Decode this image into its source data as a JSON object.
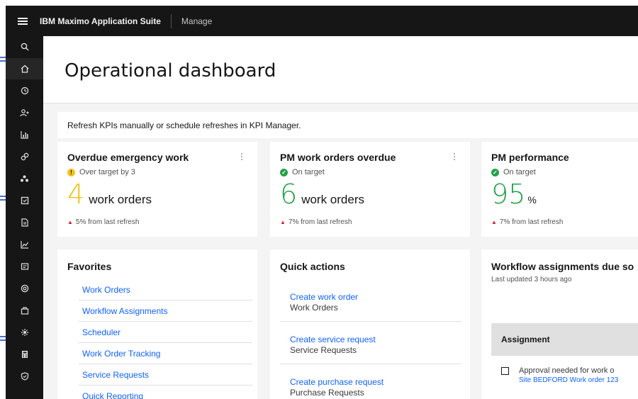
{
  "topbar": {
    "brand": "IBM Maximo Application Suite",
    "app_name": "Manage"
  },
  "sidenav": {
    "icons": [
      "search-icon",
      "home-icon",
      "history-icon",
      "people-icon",
      "chart-icon",
      "link-icon",
      "group-icon",
      "task-icon",
      "document-icon",
      "graph-icon",
      "report-icon",
      "support-icon",
      "inventory-icon",
      "settings-icon",
      "calculator-icon",
      "shield-icon"
    ]
  },
  "header": {
    "title": "Operational dashboard"
  },
  "banner": {
    "text": "Refresh KPIs manually or schedule refreshes in KPI Manager."
  },
  "kpis": [
    {
      "title": "Overdue emergency work",
      "menu": "⋮",
      "status": "Over target by 3",
      "status_icon": "!",
      "status_type": "warning",
      "value": "4",
      "value_color": "#f1c21b",
      "unit": "work orders",
      "change": "5% from last refresh"
    },
    {
      "title": "PM work orders overdue",
      "menu": "⋮",
      "status": "On target",
      "status_icon": "✓",
      "status_type": "ok",
      "value": "6",
      "value_color": "#24a148",
      "unit": "work orders",
      "change": "7% from last refresh"
    },
    {
      "title": "PM performance",
      "status": "On target",
      "status_icon": "✓",
      "status_type": "ok",
      "value": "95",
      "value_color": "#24a148",
      "unit": "%",
      "change": "7% from last refresh"
    }
  ],
  "favorites": {
    "title": "Favorites",
    "items": [
      "Work Orders",
      "Workflow Assignments",
      "Scheduler",
      "Work Order Tracking",
      "Service Requests",
      "Quick Reporting"
    ]
  },
  "quick_actions": {
    "title": "Quick actions",
    "items": [
      {
        "label": "Create work order",
        "app": "Work Orders"
      },
      {
        "label": "Create service request",
        "app": "Service Requests"
      },
      {
        "label": "Create purchase request",
        "app": "Purchase Requests"
      }
    ]
  },
  "workflow": {
    "title": "Workflow assignments due so",
    "updated": "Last updated 3 hours ago",
    "column": "Assignment",
    "rows": [
      {
        "text": "Approval needed for work o",
        "link": "Site BEDFORD Work order 123"
      }
    ]
  },
  "colors": {
    "shell": "#161616",
    "link": "#0f62fe",
    "warning": "#f1c21b",
    "success": "#24a148",
    "trend": "#da1e28"
  }
}
